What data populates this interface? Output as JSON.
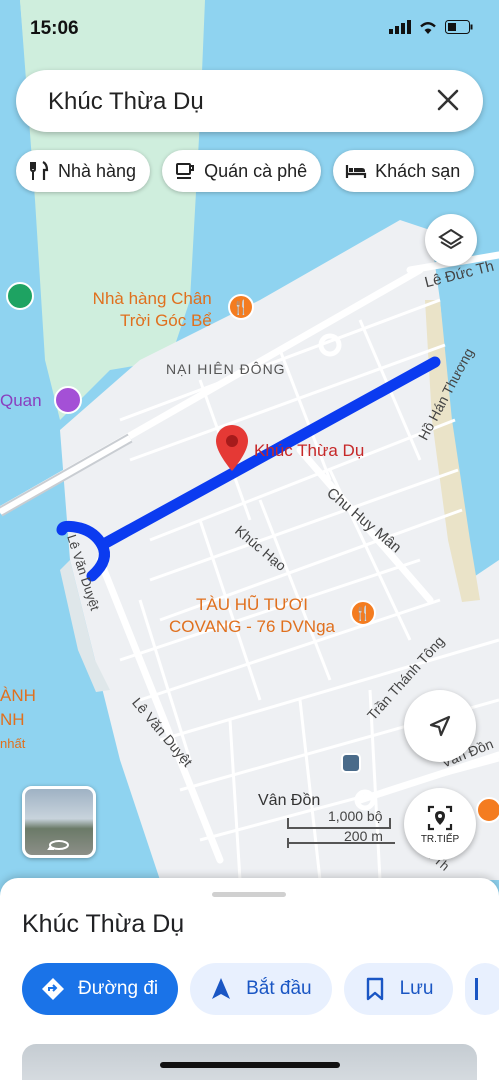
{
  "status": {
    "time": "15:06"
  },
  "search": {
    "query": "Khúc Thừa Dụ"
  },
  "chips": [
    {
      "label": "Nhà hàng",
      "icon": "fork-knife-icon"
    },
    {
      "label": "Quán cà phê",
      "icon": "coffee-cup-icon"
    },
    {
      "label": "Khách sạn",
      "icon": "bed-icon"
    }
  ],
  "map": {
    "labels": {
      "nha_hang_1": "Nhà hàng Chân",
      "nha_hang_2": "Trời Góc Bể",
      "district": "NẠI HIÊN ĐÔNG",
      "quan": "Quan",
      "le_duc_tho": "Lê Đức Th",
      "ho_han_thuong": "Hồ Hán Thương",
      "selected": "Khúc Thừa Dụ",
      "chu_huy_man": "Chu Huy Mân",
      "le_van_duyet_1": "Lê Văn Duyệt",
      "khuc_hao": "Khúc Hạo",
      "tau_hu_1": "TÀU HŨ TƯƠI",
      "tau_hu_2": "COVANG - 76 DVNga",
      "tran_thanh_tong": "Trần Thánh Tông",
      "le_van_duyet_2": "Lê Văn Duyệt",
      "anh": "ÀNH",
      "nh": "NH",
      "nhat": "nhất",
      "van_don": "Vân Đồn",
      "van_don_r": "Vân Đồn",
      "tran_th": "Trần Th"
    }
  },
  "scale": {
    "feet": "1,000 bộ",
    "meters": "200 m"
  },
  "fabs": {
    "next_label": "TR.TIẾP"
  },
  "sheet": {
    "title": "Khúc Thừa Dụ",
    "actions": [
      {
        "label": "Đường đi",
        "icon": "directions-icon"
      },
      {
        "label": "Bắt đầu",
        "icon": "navigation-arrow-icon"
      },
      {
        "label": "Lưu",
        "icon": "bookmark-icon"
      }
    ]
  },
  "colors": {
    "water": "#8fd3f0",
    "land": "#eef0f3",
    "park": "#cfeedd",
    "route": "#0b3bf0",
    "accent": "#1a73e8",
    "pin": "#e53935",
    "poi_orange": "#f47c20"
  }
}
